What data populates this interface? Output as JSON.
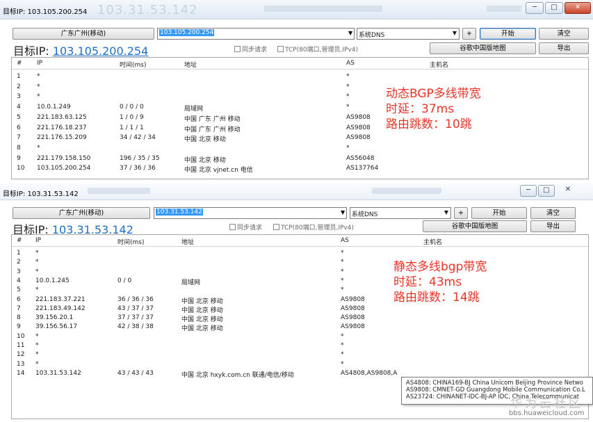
{
  "window1": {
    "title": "目标IP: 103.105.200.254",
    "title_ghost": "103.31.53.142",
    "location_button": "广东广州(移动)",
    "ip_value": "103.105.200.254",
    "dns_select": "系统DNS",
    "plus": "+",
    "start": "开始",
    "clear": "清空",
    "target_label": "目标IP:",
    "target_ip": "103.105.200.254",
    "sync_label": "同步请求",
    "tcp_label": "TCP(80端口,管理员,IPv4)",
    "map_button": "谷歌中国版地图",
    "export": "导出",
    "columns": {
      "num": "#",
      "ip": "IP",
      "time": "时间(ms)",
      "addr": "地址",
      "as": "AS",
      "host": "主机名"
    },
    "rows": [
      {
        "n": "1",
        "ip": "*",
        "t": "",
        "a": "",
        "as": "*"
      },
      {
        "n": "2",
        "ip": "*",
        "t": "",
        "a": "",
        "as": "*"
      },
      {
        "n": "3",
        "ip": "*",
        "t": "",
        "a": "",
        "as": "*"
      },
      {
        "n": "4",
        "ip": "10.0.1.249",
        "t": "0 / 0 / 0",
        "a": "局域网",
        "as": "*"
      },
      {
        "n": "5",
        "ip": "221.183.63.125",
        "t": "1 / 0 / 9",
        "a": "中国 广东 广州 移动",
        "as": "AS9808"
      },
      {
        "n": "6",
        "ip": "221.176.18.237",
        "t": "1 / 1 / 1",
        "a": "中国 广东 广州 移动",
        "as": "AS9808"
      },
      {
        "n": "7",
        "ip": "221.176.15.209",
        "t": "34 / 42 / 34",
        "a": "中国 北京 移动",
        "as": "AS9808"
      },
      {
        "n": "8",
        "ip": "*",
        "t": "",
        "a": "",
        "as": "*"
      },
      {
        "n": "9",
        "ip": "221.179.158.150",
        "t": "196 / 35 / 35",
        "a": "中国 北京 移动",
        "as": "AS56048"
      },
      {
        "n": "10",
        "ip": "103.105.200.254",
        "t": "37 / 36 / 36",
        "a": "中国 北京 vjnet.cn 电信",
        "as": "AS137764"
      }
    ],
    "annotation": [
      "动态BGP多线带宽",
      "时延：37ms",
      "路由跳数：10跳"
    ]
  },
  "window2": {
    "title": "目标IP: 103.31.53.142",
    "location_button": "广东广州(移动)",
    "ip_value": "103.31.53.142",
    "dns_select": "系统DNS",
    "plus": "+",
    "start": "开始",
    "clear": "清空",
    "target_label": "目标IP:",
    "target_ip": "103.31.53.142",
    "sync_label": "同步请求",
    "tcp_label": "TCP(80端口,管理员,IPv4)",
    "map_button": "谷歌中国版地图",
    "export": "导出",
    "columns": {
      "num": "#",
      "ip": "IP",
      "time": "时间(ms)",
      "addr": "地址",
      "as": "AS",
      "host": "主机名"
    },
    "rows": [
      {
        "n": "1",
        "ip": "*",
        "t": "",
        "a": "",
        "as": "*"
      },
      {
        "n": "2",
        "ip": "*",
        "t": "",
        "a": "",
        "as": "*"
      },
      {
        "n": "3",
        "ip": "*",
        "t": "",
        "a": "",
        "as": "*"
      },
      {
        "n": "4",
        "ip": "10.0.1.245",
        "t": "0 / 0",
        "a": "局域网",
        "as": "*"
      },
      {
        "n": "5",
        "ip": "*",
        "t": "",
        "a": "",
        "as": "*"
      },
      {
        "n": "6",
        "ip": "221.183.37.221",
        "t": "36 / 36 / 36",
        "a": "中国 北京 移动",
        "as": "AS9808"
      },
      {
        "n": "7",
        "ip": "221.183.49.142",
        "t": "43 / 37 / 37",
        "a": "中国 北京 移动",
        "as": "AS9808"
      },
      {
        "n": "8",
        "ip": "39.156.20.1",
        "t": "37 / 37 / 37",
        "a": "中国 北京 移动",
        "as": "AS9808"
      },
      {
        "n": "9",
        "ip": "39.156.56.17",
        "t": "42 / 38 / 38",
        "a": "中国 北京 移动",
        "as": "AS9808"
      },
      {
        "n": "10",
        "ip": "*",
        "t": "",
        "a": "",
        "as": "*"
      },
      {
        "n": "11",
        "ip": "*",
        "t": "",
        "a": "",
        "as": "*"
      },
      {
        "n": "12",
        "ip": "*",
        "t": "",
        "a": "",
        "as": "*"
      },
      {
        "n": "13",
        "ip": "*",
        "t": "",
        "a": "",
        "as": "*"
      },
      {
        "n": "14",
        "ip": "103.31.53.142",
        "t": "43 / 43 / 43",
        "a": "中国 北京 hxyk.com.cn 联通/电信/移动",
        "as": "AS4808,AS9808,A"
      }
    ],
    "annotation": [
      "静态多线bgp带宽",
      "时延：43ms",
      "路由跳数：14跳"
    ]
  },
  "tooltip": [
    "AS4808: CHINA169-BJ China Unicom Beijing Province Netwo",
    "AS9808: CMNET-GD Guangdong Mobile Communication Co.L",
    "AS23724: CHINANET-IDC-BJ-AP IDC, China Telecommunicat"
  ],
  "watermark": {
    "text": "华为云社区",
    "url": "bbs.huaweicloud.com"
  },
  "window_controls": {
    "minimize": "─",
    "maximize": "□",
    "close": "✕"
  },
  "colors": {
    "annotation": "#e8352a",
    "link_ip": "#1f6fc6",
    "selection": "#3399ff"
  }
}
